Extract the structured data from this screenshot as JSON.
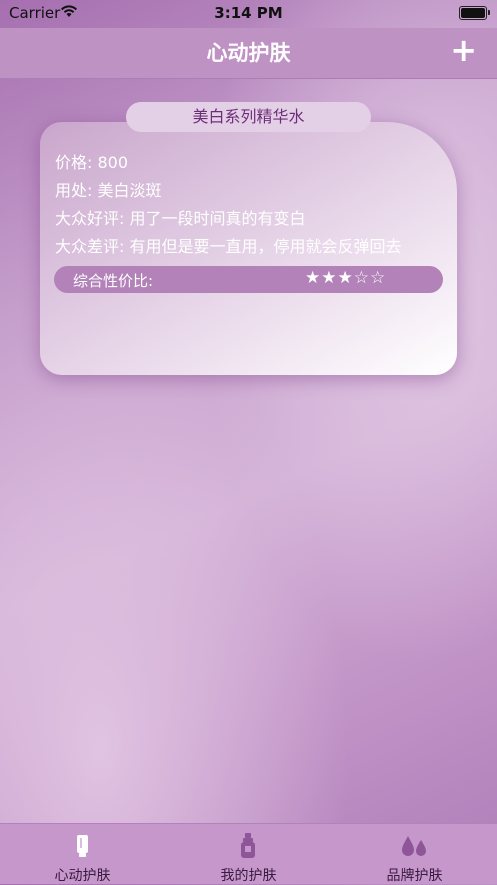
{
  "status": {
    "carrier": "Carrier",
    "time": "3:14 PM"
  },
  "nav": {
    "title": "心动护肤",
    "add_label": "+"
  },
  "card": {
    "title": "美白系列精华水",
    "price": "价格: 800",
    "usage": "用处: 美白淡斑",
    "good_review": "大众好评: 用了一段时间真的有变白",
    "bad_review": "大众差评: 有用但是要一直用，停用就会反弹回去",
    "rating_label": "综合性价比:",
    "rating_stars": "★★★☆☆",
    "rating_value": 3,
    "rating_max": 5
  },
  "tabs": [
    {
      "label": "心动护肤",
      "icon": "tube-icon"
    },
    {
      "label": "我的护肤",
      "icon": "bottle-icon"
    },
    {
      "label": "品牌护肤",
      "icon": "drops-icon"
    }
  ],
  "colors": {
    "nav_bg": "#bf92c4",
    "tab_bg": "#c697cb",
    "accent": "#6d2e78",
    "rating_bar": "#b282b9"
  }
}
